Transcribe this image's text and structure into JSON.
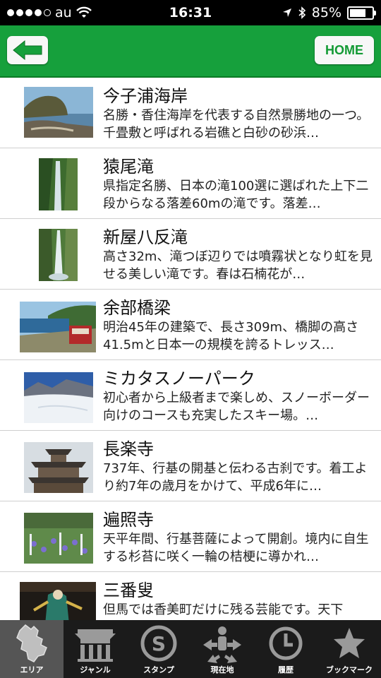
{
  "status": {
    "carrier": "au",
    "time": "16:31",
    "battery": "85%",
    "battery_level": 0.85
  },
  "nav": {
    "home_label": "HOME"
  },
  "items": [
    {
      "title": "今子浦海岸",
      "desc": "名勝・香住海岸を代表する自然景勝地の一つ。千畳敷と呼ばれる岩礁と白砂の砂浜…"
    },
    {
      "title": "猿尾滝",
      "desc": "県指定名勝、日本の滝100選に選ばれた上下二段からなる落差60mの滝です。落差…"
    },
    {
      "title": "新屋八反滝",
      "desc": "高さ32m、滝つぼ辺りでは噴霧状となり虹を見せる美しい滝です。春は石楠花が…"
    },
    {
      "title": "余部橋梁",
      "desc": "明治45年の建築で、長さ309m、橋脚の高さ41.5mと日本一の規模を誇るトレッス…"
    },
    {
      "title": "ミカタスノーパーク",
      "desc": "初心者から上級者まで楽しめ、スノーボーダー向けのコースも充実したスキー場。…"
    },
    {
      "title": "長楽寺",
      "desc": "737年、行基の開基と伝わる古刹です。着工より約7年の歳月をかけて、平成6年に…"
    },
    {
      "title": "遍照寺",
      "desc": "天平年間、行基菩薩によって開創。境内に自生する杉苔に咲く一輪の桔梗に導かれ…"
    },
    {
      "title": "三番叟",
      "desc": "但馬では香美町だけに残る芸能です。天下"
    }
  ],
  "tabs": [
    {
      "label": "エリア",
      "icon": "map-region-icon"
    },
    {
      "label": "ジャンル",
      "icon": "temple-icon"
    },
    {
      "label": "スタンプ",
      "icon": "stamp-icon"
    },
    {
      "label": "現在地",
      "icon": "current-location-icon"
    },
    {
      "label": "履歴",
      "icon": "clock-icon"
    },
    {
      "label": "ブックマーク",
      "icon": "star-icon"
    }
  ]
}
